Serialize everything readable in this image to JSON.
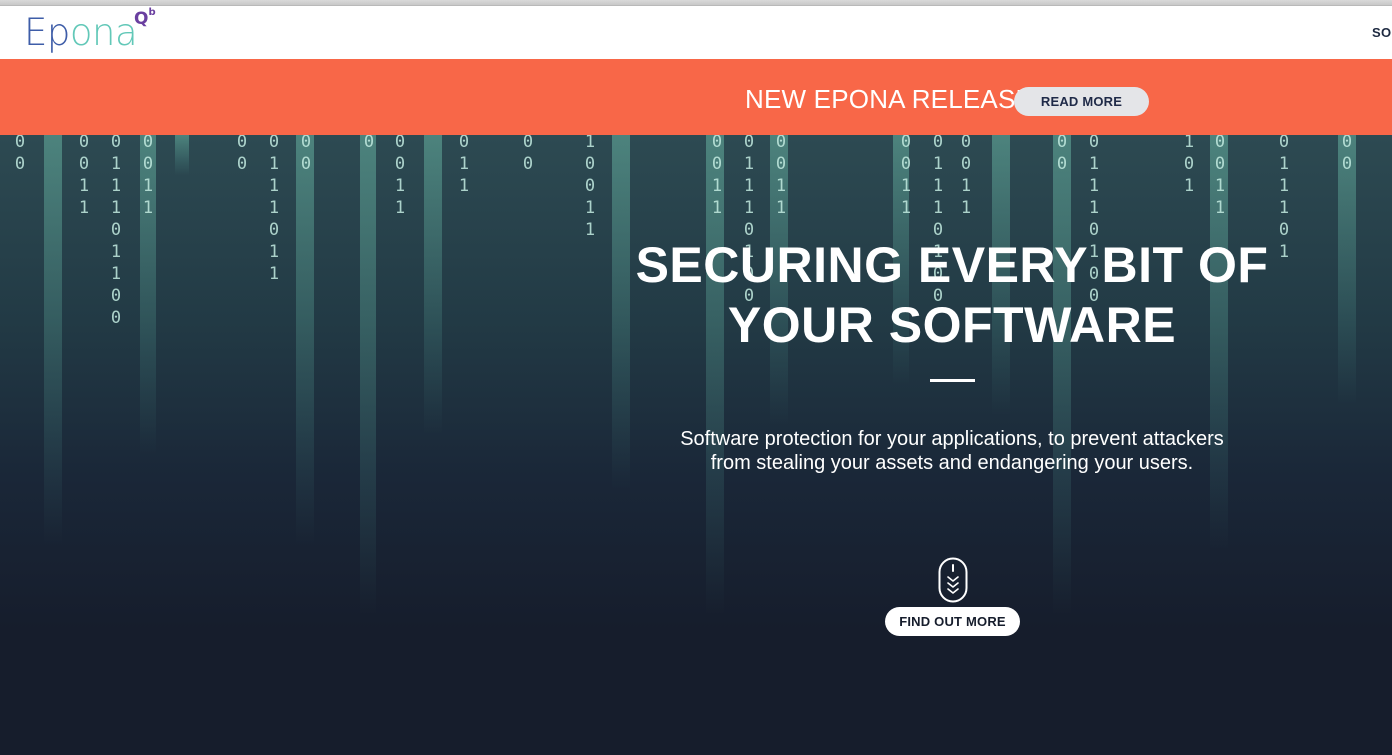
{
  "header": {
    "logo_text_dark": "Ep",
    "logo_text_light": "ona",
    "logo_mark": "Q",
    "logo_mark_sup": "b",
    "nav_partial": "SOL"
  },
  "banner": {
    "text": "NEW EPONA RELEASE",
    "button_label": "READ MORE"
  },
  "hero": {
    "title": "SECURING EVERY BIT OF YOUR SOFTWARE",
    "subtitle": "Software protection for your applications, to prevent attackers from stealing your assets and endangering your users.",
    "scroll_icon": "mouse-scroll-icon",
    "button_label": "FIND OUT MORE"
  },
  "code_rain_columns": [
    "0\n0",
    "0\n0\n1\n1",
    "0\n1\n1\n1\n0\n1\n1\n0\n0",
    "0\n0\n1\n1",
    "0\n0",
    "0\n1\n1\n1\n0\n1\n1",
    "0\n0",
    "0",
    "0\n0\n1\n1",
    "0\n1\n1",
    "0\n0",
    "1\n0\n0\n1\n1",
    "0\n0\n1\n1",
    "0\n1\n1\n1\n0\n1\n0\n0",
    "0\n0\n1\n1",
    "0\n0\n1\n1",
    "0\n1\n1\n1\n0\n1\n0\n0",
    "0\n0\n1\n1",
    "0\n0",
    "0\n1\n1\n1\n0\n1\n0\n0",
    "1\n0\n1",
    "0\n0\n1\n1",
    "0\n1\n1\n1\n0\n1",
    "0\n0"
  ],
  "colors": {
    "banner": "#f86748",
    "hero_bg": "#161d2c",
    "logo_blue": "#3e5da8",
    "logo_teal": "#62c8b8",
    "logo_purple": "#6a3fa0"
  }
}
